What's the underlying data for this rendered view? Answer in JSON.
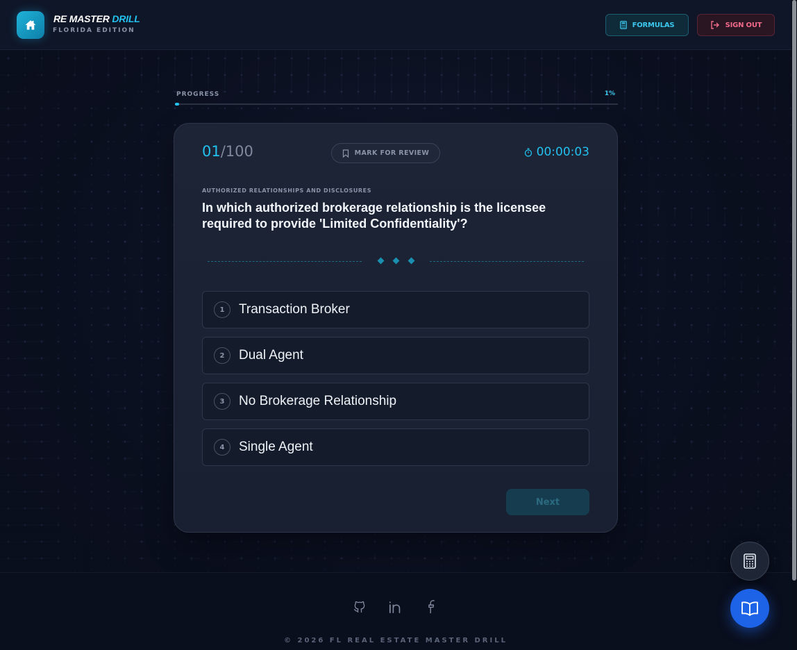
{
  "header": {
    "brand_primary": "RE MASTER",
    "brand_accent": "DRILL",
    "brand_subtitle": "FLORIDA EDITION",
    "logo_icon": "house-icon",
    "formulas_label": "FORMULAS",
    "signout_label": "SIGN OUT"
  },
  "progress": {
    "label": "PROGRESS",
    "percent_text": "1%",
    "percent_value": 1
  },
  "quiz": {
    "current": "01",
    "total": "/100",
    "mark_review_label": "MARK FOR REVIEW",
    "timer": "00:00:03",
    "category": "AUTHORIZED RELATIONSHIPS AND DISCLOSURES",
    "question": "In which authorized brokerage relationship is the licensee required to provide 'Limited Confidentiality'?",
    "options": [
      {
        "num": "1",
        "text": "Transaction Broker"
      },
      {
        "num": "2",
        "text": "Dual Agent"
      },
      {
        "num": "3",
        "text": "No Brokerage Relationship"
      },
      {
        "num": "4",
        "text": "Single Agent"
      }
    ],
    "next_label": "Next"
  },
  "footer": {
    "icons": [
      "github-icon",
      "linkedin-icon",
      "facebook-icon"
    ],
    "copyright": "© 2026 FL REAL ESTATE MASTER DRILL"
  },
  "colors": {
    "accent": "#22c1ee",
    "signout": "#f06a8a",
    "fab_blue": "#1d63e8",
    "background": "#0b1020"
  }
}
